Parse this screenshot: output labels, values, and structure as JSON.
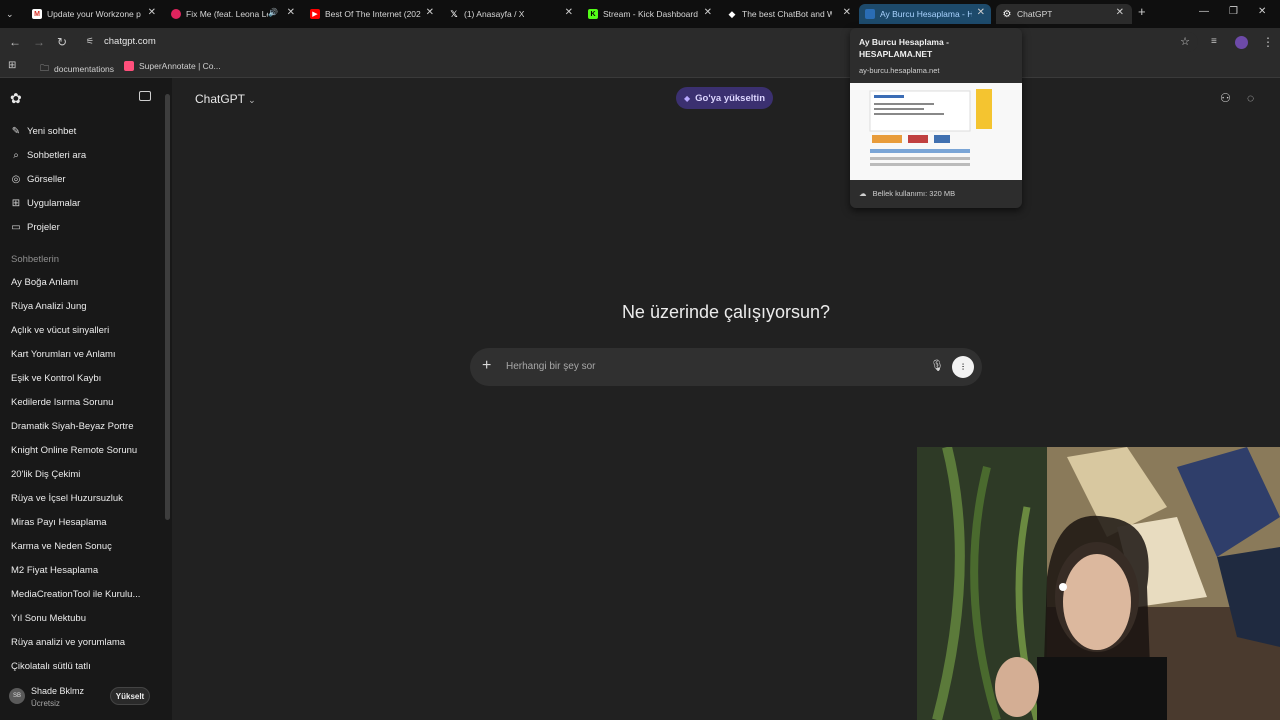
{
  "browser": {
    "tabs": [
      {
        "title": "Update your Workzone p",
        "favicon": "gmail-icon"
      },
      {
        "title": "Fix Me (feat. Leona Le",
        "favicon": "music-icon"
      },
      {
        "title": "Best Of The Internet (202",
        "favicon": "youtube-icon"
      },
      {
        "title": "(1) Anasayfa / X",
        "favicon": "x-icon"
      },
      {
        "title": "Stream - Kick Dashboard",
        "favicon": "kick-icon"
      },
      {
        "title": "The best ChatBot and W",
        "favicon": "chatbot-icon"
      },
      {
        "title": "Ay Burcu Hesaplama - H",
        "favicon": "hesaplama-icon"
      },
      {
        "title": "ChatGPT",
        "favicon": "chatgpt-icon"
      }
    ],
    "url": "chatgpt.com",
    "bookmarks": [
      "documentations",
      "SuperAnnotate | Co..."
    ],
    "tooltip": {
      "title": "Ay Burcu Hesaplama - HESAPLAMA.NET",
      "domain": "ay-burcu.hesaplama.net",
      "memory": "Bellek kullanımı: 320 MB"
    }
  },
  "sidebar": {
    "actions": [
      {
        "label": "Yeni sohbet",
        "icon": "edit-icon"
      },
      {
        "label": "Sohbetleri ara",
        "icon": "search-icon"
      },
      {
        "label": "Görseller",
        "icon": "image-icon"
      },
      {
        "label": "Uygulamalar",
        "icon": "apps-icon"
      },
      {
        "label": "Projeler",
        "icon": "folder-icon"
      }
    ],
    "section_label": "Sohbetlerin",
    "chats": [
      "Ay Boğa Anlamı",
      "Rüya Analizi Jung",
      "Açlık ve vücut sinyalleri",
      "Kart Yorumları ve Anlamı",
      "Eşik ve Kontrol Kaybı",
      "Kedilerde Isırma Sorunu",
      "Dramatik Siyah-Beyaz Portre",
      "Knight Online Remote Sorunu",
      "20'lik Diş Çekimi",
      "Rüya ve İçsel Huzursuzluk",
      "Miras Payı Hesaplama",
      "Karma ve Neden Sonuç",
      "M2 Fiyat Hesaplama",
      "MediaCreationTool ile Kurulu...",
      "Yıl Sonu Mektubu",
      "Rüya analizi ve yorumlama",
      "Çikolatalı sütlü tatlı"
    ],
    "user": {
      "initials": "SB",
      "name": "Shade Bklmz",
      "plan": "Ücretsiz",
      "upgrade_label": "Yükselt"
    }
  },
  "main": {
    "model_label": "ChatGPT",
    "upgrade_pill": "Go'ya yükseltin",
    "headline": "Ne üzerinde çalışıyorsun?",
    "input_placeholder": "Herhangi bir şey sor"
  },
  "colors": {
    "accent_pill": "#3b3070",
    "background": "#212121",
    "sidebar": "#181818"
  }
}
